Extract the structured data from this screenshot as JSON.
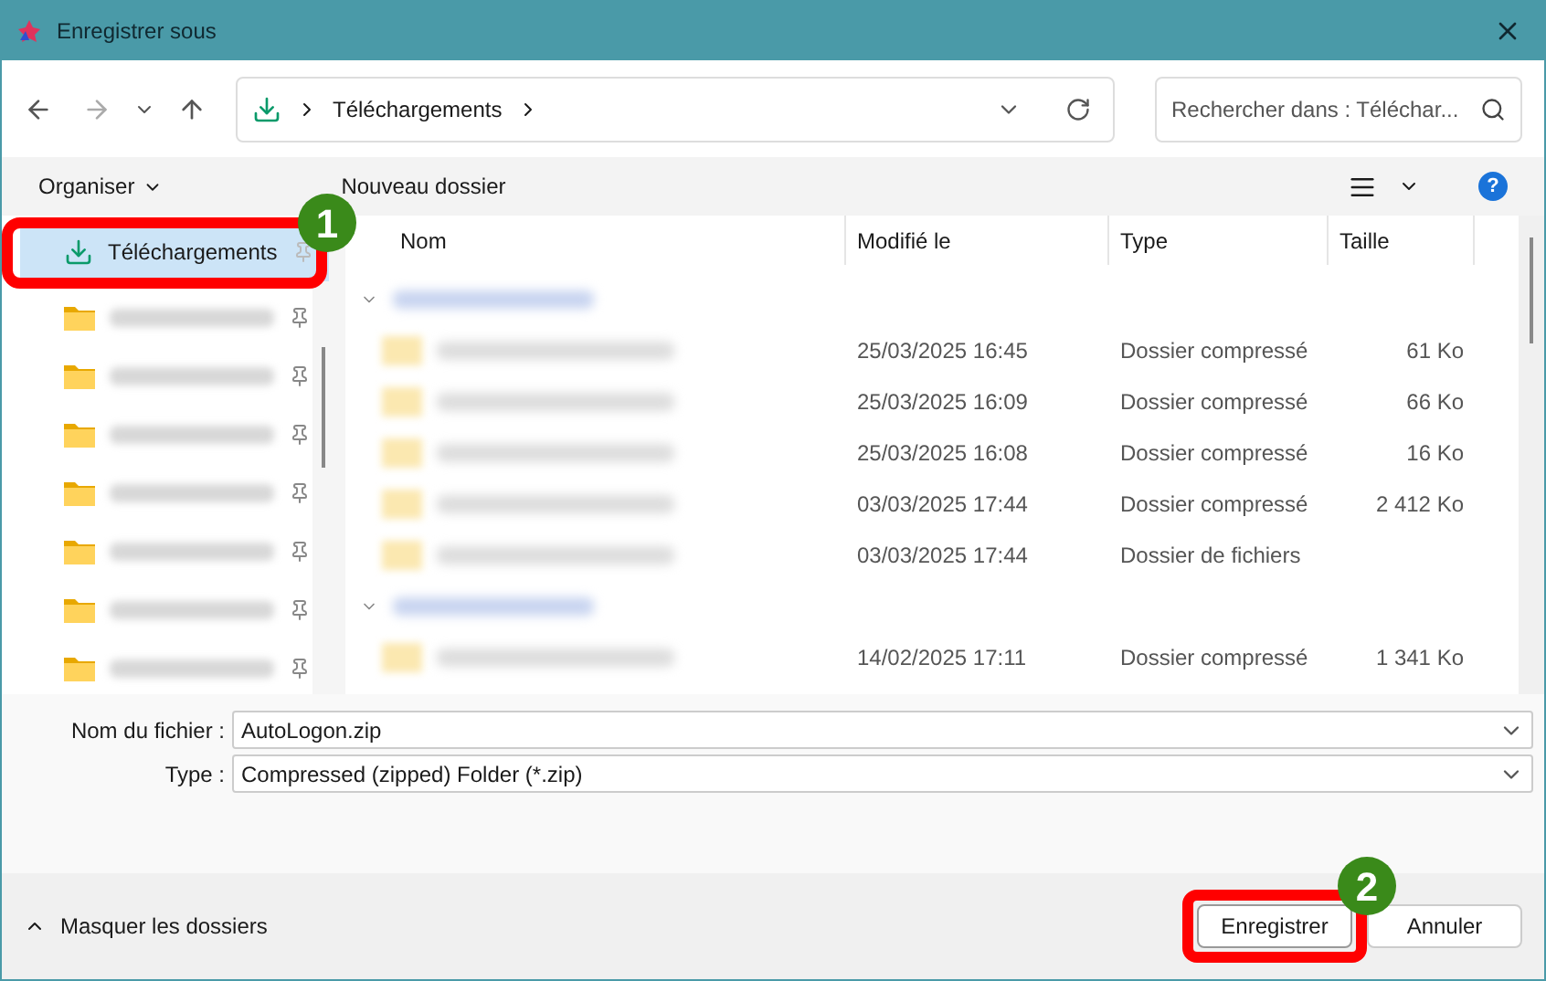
{
  "window": {
    "title": "Enregistrer sous"
  },
  "address": {
    "path": "Téléchargements"
  },
  "search": {
    "placeholder": "Rechercher dans : Téléchar..."
  },
  "toolbar": {
    "organize": "Organiser",
    "new_folder": "Nouveau dossier",
    "help": "?"
  },
  "sidebar": {
    "items": [
      {
        "kind": "downloads",
        "label": "Téléchargements",
        "selected": true
      },
      {
        "kind": "folder",
        "selected": false
      },
      {
        "kind": "folder",
        "selected": false
      },
      {
        "kind": "folder",
        "selected": false
      },
      {
        "kind": "folder",
        "selected": false
      },
      {
        "kind": "folder",
        "selected": false
      },
      {
        "kind": "folder",
        "selected": false
      },
      {
        "kind": "folder",
        "selected": false
      }
    ]
  },
  "columns": [
    "Nom",
    "Modifié le",
    "Type",
    "Taille"
  ],
  "rows": [
    {
      "kind": "group"
    },
    {
      "kind": "file",
      "modified": "25/03/2025 16:45",
      "type": "Dossier compressé",
      "size": "61 Ko"
    },
    {
      "kind": "file",
      "modified": "25/03/2025 16:09",
      "type": "Dossier compressé",
      "size": "66 Ko"
    },
    {
      "kind": "file",
      "modified": "25/03/2025 16:08",
      "type": "Dossier compressé",
      "size": "16 Ko"
    },
    {
      "kind": "file",
      "modified": "03/03/2025 17:44",
      "type": "Dossier compressé",
      "size": "2 412 Ko"
    },
    {
      "kind": "file",
      "modified": "03/03/2025 17:44",
      "type": "Dossier de fichiers"
    },
    {
      "kind": "group"
    },
    {
      "kind": "file",
      "modified": "14/02/2025 17:11",
      "type": "Dossier compressé",
      "size": "1 341 Ko"
    }
  ],
  "filename": {
    "label": "Nom du fichier :",
    "value": "AutoLogon.zip"
  },
  "filetype": {
    "label": "Type :",
    "value": "Compressed (zipped) Folder (*.zip)"
  },
  "footer": {
    "toggle": "Masquer les dossiers",
    "buttons": [
      {
        "label": "Enregistrer",
        "kind": "primary"
      },
      {
        "label": "Annuler",
        "kind": "secondary"
      }
    ]
  },
  "annotations": [
    {
      "label": "1"
    },
    {
      "label": "2"
    }
  ]
}
